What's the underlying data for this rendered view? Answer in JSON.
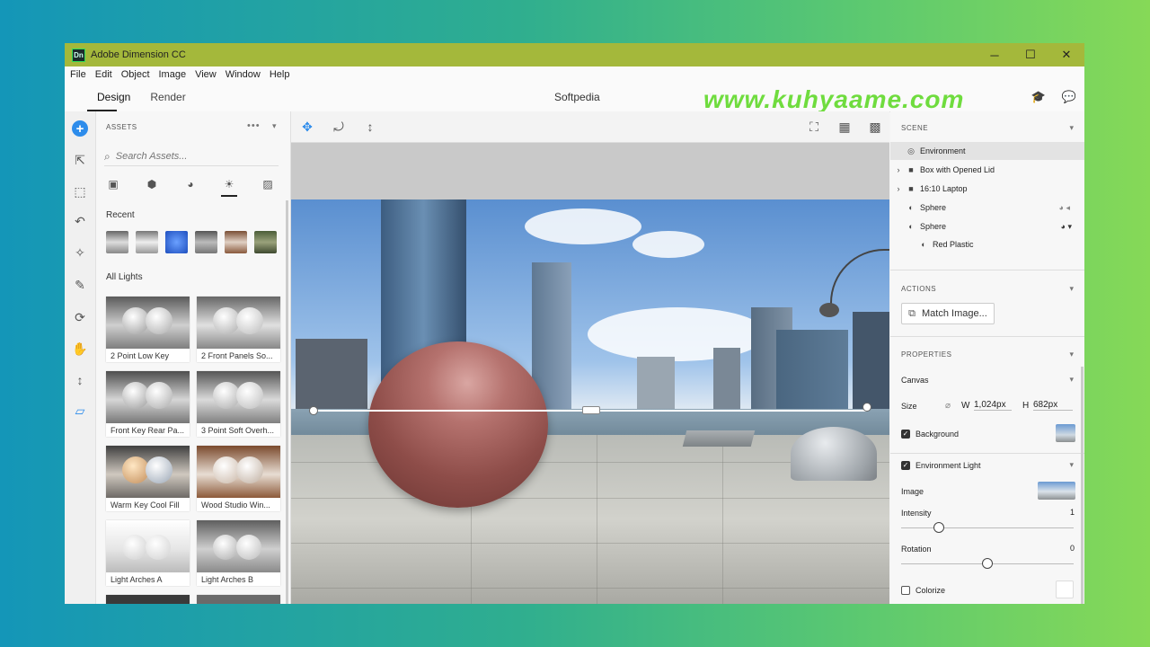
{
  "window": {
    "title": "Adobe Dimension CC",
    "app_icon": "Dn",
    "minimize": "─",
    "maximize": "☐",
    "close": "✕"
  },
  "menu": [
    "File",
    "Edit",
    "Object",
    "Image",
    "View",
    "Window",
    "Help"
  ],
  "modes": {
    "design": "Design",
    "render": "Render"
  },
  "document_title": "Softpedia",
  "watermark": "www.kuhyaame.com",
  "assets": {
    "header": "ASSETS",
    "more": "•••",
    "search_placeholder": "Search Assets...",
    "recent_label": "Recent",
    "all_label": "All Lights",
    "items": [
      "2 Point Low Key",
      "2 Front Panels So...",
      "Front Key Rear Pa...",
      "3 Point Soft Overh...",
      "Warm Key Cool Fill",
      "Wood Studio Win...",
      "Light Arches A",
      "Light Arches B"
    ]
  },
  "scene": {
    "header": "SCENE",
    "items": [
      {
        "label": "Environment",
        "icon": "globe-icon"
      },
      {
        "label": "Box with Opened Lid",
        "icon": "folder-icon"
      },
      {
        "label": "16:10 Laptop",
        "icon": "folder-icon"
      },
      {
        "label": "Sphere",
        "icon": "material-icon"
      },
      {
        "label": "Sphere",
        "icon": "material-icon"
      },
      {
        "label": "Red Plastic",
        "icon": "material-icon"
      }
    ]
  },
  "actions": {
    "header": "ACTIONS",
    "match_image": "Match Image..."
  },
  "properties": {
    "header": "PROPERTIES",
    "canvas": "Canvas",
    "size_label": "Size",
    "w_label": "W",
    "w_value": "1,024px",
    "h_label": "H",
    "h_value": "682px",
    "background": "Background",
    "env_light": "Environment Light",
    "image": "Image",
    "intensity": "Intensity",
    "intensity_value": "1",
    "intensity_level": 0.22,
    "rotation": "Rotation",
    "rotation_value": "0",
    "rotation_level": 0.5,
    "colorize": "Colorize"
  },
  "colors": {
    "accent": "#2d8ceb",
    "titlebar": "#a4b83b",
    "watermark": "#6fdc3e"
  }
}
